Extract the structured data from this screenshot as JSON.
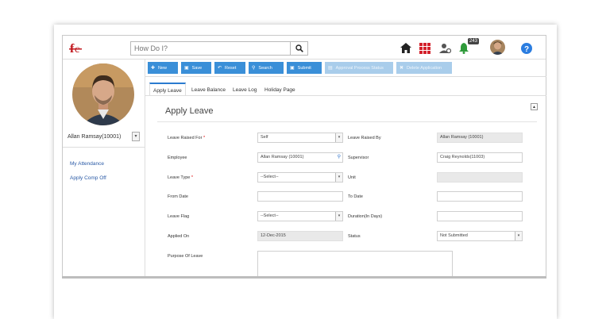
{
  "header": {
    "search_placeholder": "How Do I?",
    "notification_count": "243"
  },
  "sidebar": {
    "user_selected": "Allan Ramsay(10001)",
    "links": [
      "My Attendance",
      "Apply Comp Off"
    ]
  },
  "toolbar": {
    "buttons": [
      "New",
      "Save",
      "Reset",
      "Search",
      "Submit",
      "Approval Process Status",
      "Delete Application"
    ]
  },
  "tabs": [
    "Apply Leave",
    "Leave Balance",
    "Leave Log",
    "Holiday Page"
  ],
  "form": {
    "title": "Apply Leave",
    "leave_raised_for_label": "Leave Raised For",
    "leave_raised_for_value": "Self",
    "leave_raised_by_label": "Leave Raised By",
    "leave_raised_by_value": "Allan Ramsay (10001)",
    "employee_label": "Employee",
    "employee_value": "Allan Ramsay (10001)",
    "supervisor_label": "Supervisor",
    "supervisor_value": "Craig Reynolds(11003)",
    "leave_type_label": "Leave Type",
    "leave_type_value": "--Select--",
    "unit_label": "Unit",
    "from_date_label": "From Date",
    "to_date_label": "To Date",
    "leave_flag_label": "Leave Flag",
    "leave_flag_value": "--Select--",
    "duration_label": "Duration(In Days)",
    "applied_on_label": "Applied On",
    "applied_on_value": "12-Dec-2015",
    "status_label": "Status",
    "status_value": "Not Submitted",
    "purpose_label": "Purpose Of Leave",
    "required_mark": "*"
  },
  "colors": {
    "toolbar_button": "#3a8fd8",
    "toolbar_button_disabled": "#a9cdeb",
    "link": "#2a5aa6",
    "tab_active": "#2a7bd0"
  }
}
